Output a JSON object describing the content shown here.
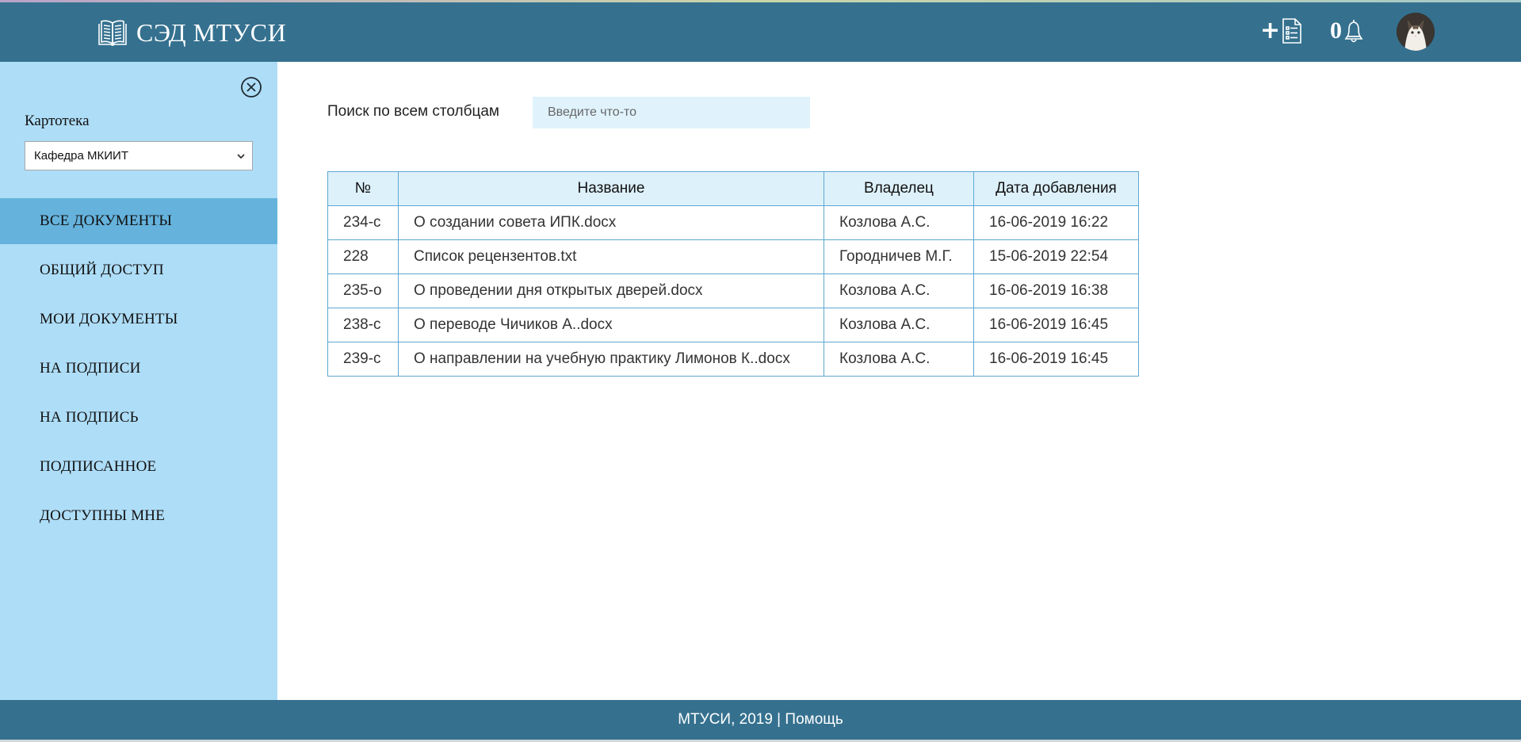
{
  "header": {
    "brand_title": "СЭД МТУСИ",
    "brand_icon": "book-icon",
    "add_document_icon": "add-document-icon",
    "notifications_count": "0",
    "notification_icon": "bell-icon",
    "avatar": "user-avatar"
  },
  "sidebar": {
    "close_icon": "close-circle-icon",
    "card_label": "Картотека",
    "card_selected": "Кафедра МКИИТ",
    "items": [
      {
        "label": "ВСЕ ДОКУМЕНТЫ",
        "active": true
      },
      {
        "label": "ОБЩИЙ ДОСТУП",
        "active": false
      },
      {
        "label": "МОИ ДОКУМЕНТЫ",
        "active": false
      },
      {
        "label": "НА ПОДПИСИ",
        "active": false
      },
      {
        "label": "НА ПОДПИСЬ",
        "active": false
      },
      {
        "label": "ПОДПИСАННОЕ",
        "active": false
      },
      {
        "label": "ДОСТУПНЫ МНЕ",
        "active": false
      }
    ]
  },
  "search": {
    "label": "Поиск по всем столбцам",
    "placeholder": "Введите что-то",
    "value": ""
  },
  "table": {
    "columns": [
      "№",
      "Название",
      "Владелец",
      "Дата добавления"
    ],
    "rows": [
      [
        "234-с",
        "О создании совета ИПК.docx",
        "Козлова А.С.",
        "16-06-2019 16:22"
      ],
      [
        "228",
        "Список рецензентов.txt",
        "Городничев М.Г.",
        "15-06-2019 22:54"
      ],
      [
        "235-о",
        "О проведении дня открытых дверей.docx",
        "Козлова А.С.",
        "16-06-2019 16:38"
      ],
      [
        "238-с",
        "О переводе Чичиков А..docx",
        "Козлова А.С.",
        "16-06-2019 16:45"
      ],
      [
        "239-с",
        "О направлении на учебную практику Лимонов К..docx",
        "Козлова А.С.",
        "16-06-2019 16:45"
      ]
    ]
  },
  "footer": {
    "copyright": "МТУСИ, 2019",
    "separator": " | ",
    "help": "Помощь"
  },
  "colors": {
    "header_bg": "#35718f",
    "sidebar_bg": "#aeddf7",
    "sidebar_active": "#65b3dd",
    "table_header_bg": "#ddf1fb",
    "table_border": "#5ea7cf",
    "search_bg": "#e0f3fc"
  }
}
